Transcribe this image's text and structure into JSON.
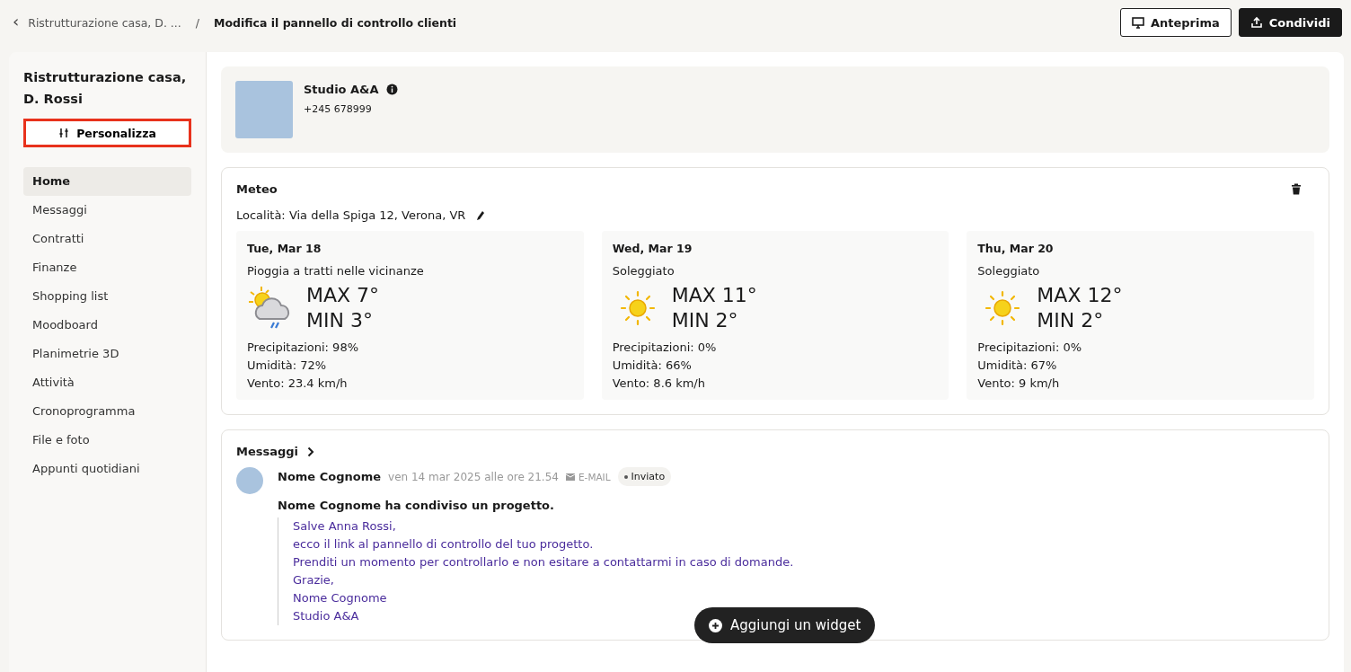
{
  "breadcrumb": {
    "back_icon": "‹",
    "parent": "Ristrutturazione casa, D. ...",
    "separator": "/",
    "current": "Modifica il pannello di controllo clienti"
  },
  "header_buttons": [
    {
      "kind": "outline",
      "label": "Anteprima"
    },
    {
      "kind": "filled",
      "label": "Condividi"
    }
  ],
  "sidebar": {
    "title": "Ristrutturazione casa, D. Rossi",
    "customize_button": {
      "label": "Personalizza",
      "highlighted": true
    },
    "items": [
      {
        "label": "Home",
        "selected": true
      },
      {
        "label": "Messaggi",
        "selected": false
      },
      {
        "label": "Contratti",
        "selected": false
      },
      {
        "label": "Finanze",
        "selected": false
      },
      {
        "label": "Shopping list",
        "selected": false
      },
      {
        "label": "Moodboard",
        "selected": false
      },
      {
        "label": "Planimetrie 3D",
        "selected": false
      },
      {
        "label": "Attività",
        "selected": false
      },
      {
        "label": "Cronoprogramma",
        "selected": false
      },
      {
        "label": "File e foto",
        "selected": false
      },
      {
        "label": "Appunti quotidiani",
        "selected": false
      }
    ]
  },
  "company": {
    "name": "Studio A&A",
    "phone": "+245 678999"
  },
  "weather": {
    "title": "Meteo",
    "location": "Località: Via della Spiga 12, Verona, VR",
    "days": [
      {
        "date": "Tue, Mar 18",
        "condition": "Pioggia a tratti nelle vicinanze",
        "kind": "rain",
        "max": "MAX 7°",
        "min": "MIN 3°",
        "precipitation": "Precipitazioni: 98%",
        "humidity": "Umidità: 72%",
        "wind": "Vento: 23.4 km/h"
      },
      {
        "date": "Wed, Mar 19",
        "condition": "Soleggiato",
        "kind": "sunny",
        "max": "MAX 11°",
        "min": "MIN 2°",
        "precipitation": "Precipitazioni: 0%",
        "humidity": "Umidità: 66%",
        "wind": "Vento: 8.6 km/h"
      },
      {
        "date": "Thu, Mar 20",
        "condition": "Soleggiato",
        "kind": "sunny",
        "max": "MAX 12°",
        "min": "MIN 2°",
        "precipitation": "Precipitazioni: 0%",
        "humidity": "Umidità: 67%",
        "wind": "Vento: 9 km/h"
      }
    ]
  },
  "messages": {
    "title": "Messaggi",
    "sender": "Nome Cognome",
    "timestamp": "ven 14 mar 2025 alle ore 21.54",
    "channel": "E-MAIL",
    "status": "Inviato",
    "subject": "Nome Cognome ha condiviso un progetto.",
    "body": [
      "Salve Anna Rossi,",
      "ecco il link al pannello di controllo del tuo progetto.",
      "Prenditi un momento per controllarlo e non esitare a contattarmi in caso di domande.",
      "Grazie,",
      "Nome Cognome",
      "Studio A&A"
    ]
  },
  "add_widget_button": "Aggiungi un widget"
}
